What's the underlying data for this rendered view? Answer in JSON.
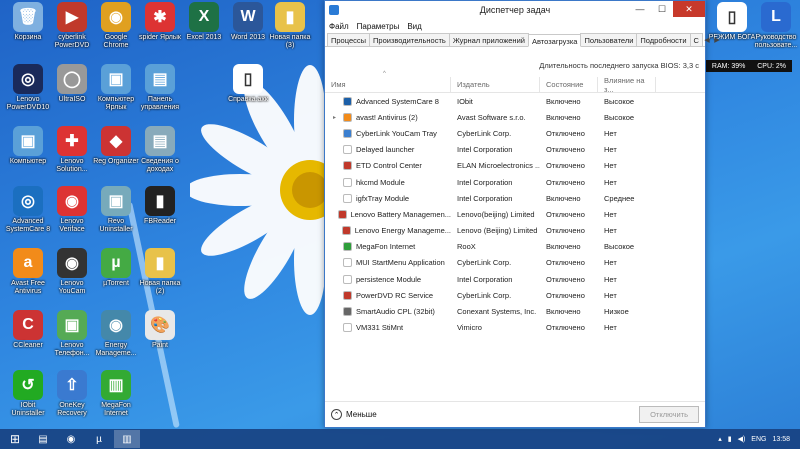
{
  "desktop": {
    "icons": [
      {
        "label": "Корзина",
        "icon": "recycle-bin-icon",
        "color": "#7fb0e0",
        "glyph": "🗑"
      },
      {
        "label": "cyberlink PowerDVD",
        "icon": "powerdvd-icon",
        "color": "#c0392b",
        "glyph": "▶"
      },
      {
        "label": "Google Chrome",
        "icon": "chrome-icon",
        "color": "#e0a020",
        "glyph": "◉"
      },
      {
        "label": "spider Ярлык",
        "icon": "spider-icon",
        "color": "#d33",
        "glyph": "✱"
      },
      {
        "label": "Excel 2013",
        "icon": "excel-icon",
        "color": "#1e7145",
        "glyph": "X"
      },
      {
        "label": "Word 2013",
        "icon": "word-icon",
        "color": "#2b579a",
        "glyph": "W"
      },
      {
        "label": "Новая папка (3)",
        "icon": "folder-icon",
        "color": "#e8c24a",
        "glyph": "▮"
      },
      {
        "label": "Lenovo PowerDVD10",
        "icon": "lenovo-powerdvd-icon",
        "color": "#1a2a5a",
        "glyph": "◎"
      },
      {
        "label": "UltraISO",
        "icon": "disc-icon",
        "color": "#999",
        "glyph": "◯"
      },
      {
        "label": "Компьютер Ярлык",
        "icon": "computer-icon",
        "color": "#5aa0d8",
        "glyph": "▣"
      },
      {
        "label": "Панель управления",
        "icon": "control-panel-icon",
        "color": "#5aa0d8",
        "glyph": "▤"
      },
      {
        "label": "Справка.ахк",
        "icon": "document-icon",
        "color": "#fff",
        "glyph": "▯"
      },
      {
        "label": "Компьютер",
        "icon": "computer-icon",
        "color": "#5aa0d8",
        "glyph": "▣"
      },
      {
        "label": "Lenovo Solution...",
        "icon": "lenovo-solution-icon",
        "color": "#d33",
        "glyph": "✚"
      },
      {
        "label": "Reg Organizer",
        "icon": "reg-organizer-icon",
        "color": "#c33",
        "glyph": "◆"
      },
      {
        "label": "Сведения о доходах",
        "icon": "doc-icon",
        "color": "#8ab",
        "glyph": "▤"
      },
      {
        "label": "Advanced SystemCare 8",
        "icon": "advanced-systemcare-icon",
        "color": "#1b6fc0",
        "glyph": "◎"
      },
      {
        "label": "Lenovo Veriface",
        "icon": "veriface-icon",
        "color": "#d33",
        "glyph": "◉"
      },
      {
        "label": "Revo Uninstaller",
        "icon": "revo-icon",
        "color": "#7ab",
        "glyph": "▣"
      },
      {
        "label": "FBReader",
        "icon": "fbreader-icon",
        "color": "#222",
        "glyph": "▮"
      },
      {
        "label": "Avast Free Antivirus",
        "icon": "avast-icon",
        "color": "#f28b1a",
        "glyph": "a"
      },
      {
        "label": "Lenovo YouCam",
        "icon": "youcam-icon",
        "color": "#333",
        "glyph": "◉"
      },
      {
        "label": "µTorrent",
        "icon": "utorrent-icon",
        "color": "#4a4",
        "glyph": "µ"
      },
      {
        "label": "Новая папка (2)",
        "icon": "folder-icon",
        "color": "#e8c24a",
        "glyph": "▮"
      },
      {
        "label": "CCleaner",
        "icon": "ccleaner-icon",
        "color": "#c33",
        "glyph": "C"
      },
      {
        "label": "Lenovo Телефон...",
        "icon": "lenovo-phone-icon",
        "color": "#5a5",
        "glyph": "▣"
      },
      {
        "label": "Energy Manageme...",
        "icon": "energy-icon",
        "color": "#48a",
        "glyph": "◉"
      },
      {
        "label": "Paint",
        "icon": "paint-icon",
        "color": "#e8e8e8",
        "glyph": "🎨"
      },
      {
        "label": "IObit Uninstaller",
        "icon": "iobit-uninstaller-icon",
        "color": "#2a2",
        "glyph": "↺"
      },
      {
        "label": "OneKey Recovery",
        "icon": "onekey-icon",
        "color": "#3a7ad0",
        "glyph": "⇧"
      },
      {
        "label": "MegaFon Internet",
        "icon": "megafon-icon",
        "color": "#3a3",
        "glyph": "▥"
      }
    ],
    "right_icons": [
      {
        "label": "РЕЖИМ БОГА",
        "icon": "document-icon",
        "color": "#fff",
        "glyph": "▯"
      },
      {
        "label": "Руководство пользовате...",
        "icon": "lenovo-guide-icon",
        "color": "#2a6ad0",
        "glyph": "L"
      }
    ]
  },
  "gadget": {
    "ram": "RAM: 39%",
    "cpu": "CPU: 2%"
  },
  "window": {
    "title": "Диспетчер задач",
    "minimize": "—",
    "maximize": "☐",
    "close": "✕",
    "menu": [
      "Файл",
      "Параметры",
      "Вид"
    ],
    "tabs": [
      "Процессы",
      "Производительность",
      "Журнал приложений",
      "Автозагрузка",
      "Пользователи",
      "Подробности",
      "С"
    ],
    "active_tab": "Автозагрузка",
    "bios_text": "Длительность последнего запуска BIOS: 3,3 с",
    "columns": [
      "Имя",
      "Издатель",
      "Состояние",
      "Влияние на з..."
    ],
    "sort_indicator": "^",
    "rows": [
      {
        "name": "Advanced SystemCare 8",
        "publisher": "IObit",
        "state": "Включено",
        "impact": "Высокое",
        "icon_color": "#1b5fa8",
        "expandable": false
      },
      {
        "name": "avast! Antivirus (2)",
        "publisher": "Avast Software s.r.o.",
        "state": "Включено",
        "impact": "Высокое",
        "icon_color": "#f28b1a",
        "expandable": true
      },
      {
        "name": "CyberLink YouCam Tray",
        "publisher": "CyberLink Corp.",
        "state": "Отключено",
        "impact": "Нет",
        "icon_color": "#3a7fd0",
        "expandable": false
      },
      {
        "name": "Delayed launcher",
        "publisher": "Intel Corporation",
        "state": "Отключено",
        "impact": "Нет",
        "icon_color": "#ffffff",
        "expandable": false
      },
      {
        "name": "ETD Control Center",
        "publisher": "ELAN Microelectronics ...",
        "state": "Отключено",
        "impact": "Нет",
        "icon_color": "#c0392b",
        "expandable": false
      },
      {
        "name": "hkcmd Module",
        "publisher": "Intel Corporation",
        "state": "Отключено",
        "impact": "Нет",
        "icon_color": "#ffffff",
        "expandable": false
      },
      {
        "name": "igfxTray Module",
        "publisher": "Intel Corporation",
        "state": "Включено",
        "impact": "Среднее",
        "icon_color": "#ffffff",
        "expandable": false
      },
      {
        "name": "Lenovo Battery Managemen...",
        "publisher": "Lenovo(beijing) Limited",
        "state": "Отключено",
        "impact": "Нет",
        "icon_color": "#c0392b",
        "expandable": false
      },
      {
        "name": "Lenovo Energy Manageme...",
        "publisher": "Lenovo (Beijing) Limited",
        "state": "Отключено",
        "impact": "Нет",
        "icon_color": "#c0392b",
        "expandable": false
      },
      {
        "name": "MegaFon Internet",
        "publisher": "RooX",
        "state": "Включено",
        "impact": "Высокое",
        "icon_color": "#2e9e3a",
        "expandable": false
      },
      {
        "name": "MUI StartMenu Application",
        "publisher": "CyberLink Corp.",
        "state": "Отключено",
        "impact": "Нет",
        "icon_color": "#ffffff",
        "expandable": false
      },
      {
        "name": "persistence Module",
        "publisher": "Intel Corporation",
        "state": "Отключено",
        "impact": "Нет",
        "icon_color": "#ffffff",
        "expandable": false
      },
      {
        "name": "PowerDVD RC Service",
        "publisher": "CyberLink Corp.",
        "state": "Отключено",
        "impact": "Нет",
        "icon_color": "#c0392b",
        "expandable": false
      },
      {
        "name": "SmartAudio CPL (32bit)",
        "publisher": "Conexant Systems, Inc.",
        "state": "Включено",
        "impact": "Низкое",
        "icon_color": "#666666",
        "expandable": false
      },
      {
        "name": "VM331 StiMnt",
        "publisher": "Vimicro",
        "state": "Отключено",
        "impact": "Нет",
        "icon_color": "#ffffff",
        "expandable": false
      }
    ],
    "less_label": "Меньше",
    "disable_label": "Отключить"
  },
  "taskbar": {
    "items": [
      {
        "name": "explorer",
        "icon": "folder-icon",
        "glyph": "▤",
        "active": false
      },
      {
        "name": "chrome",
        "icon": "chrome-icon",
        "glyph": "◉",
        "active": false
      },
      {
        "name": "utorrent",
        "icon": "utorrent-icon",
        "glyph": "µ",
        "active": false
      },
      {
        "name": "task-manager",
        "icon": "task-manager-icon",
        "glyph": "▥",
        "active": true
      }
    ],
    "lang": "ENG",
    "time": "13:58"
  }
}
